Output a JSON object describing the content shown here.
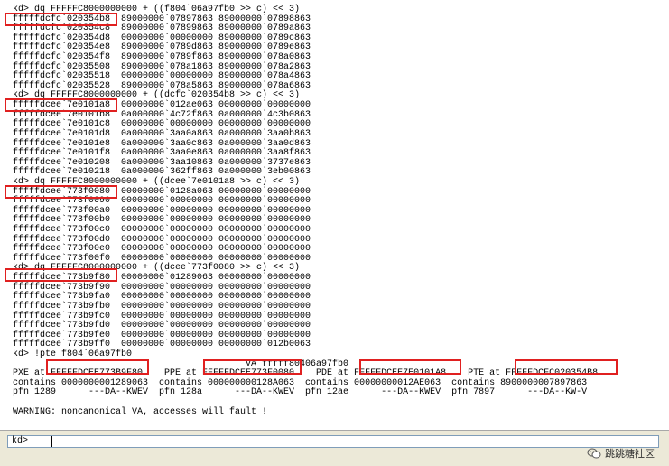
{
  "output_lines": [
    "kd> dq FFFFFC8000000000 + ((f804`06a97fb0 >> c) << 3)",
    "fffffdcfc`020354b8  89000000`07897863 89000000`07898863",
    "fffffdcfc`020354c8  89000000`07899863 89000000`0789a863",
    "fffffdcfc`020354d8  00000000`00000000 89000000`0789c863",
    "fffffdcfc`020354e8  89000000`0789d863 89000000`0789e863",
    "fffffdcfc`020354f8  89000000`0789f863 89000000`078a0863",
    "fffffdcfc`02035508  89000000`078a1863 89000000`078a2863",
    "fffffdcfc`02035518  00000000`00000000 89000000`078a4863",
    "fffffdcfc`02035528  89000000`078a5863 89000000`078a6863",
    "kd> dq FFFFFC8000000000 + ((dcfc`020354b8 >> c) << 3)",
    "fffffdcee`7e0101a8  00000000`012ae063 00000000`00000000",
    "fffffdcee`7e0101b8  0a000000`4c72f863 0a000000`4c3b0863",
    "fffffdcee`7e0101c8  00000000`00000000 00000000`00000000",
    "fffffdcee`7e0101d8  0a000000`3aa0a863 0a000000`3aa0b863",
    "fffffdcee`7e0101e8  0a000000`3aa0c863 0a000000`3aa0d863",
    "fffffdcee`7e0101f8  0a000000`3aa0e863 0a000000`3aa8f863",
    "fffffdcee`7e010208  0a000000`3aa10863 0a000000`3737e863",
    "fffffdcee`7e010218  0a000000`362ff863 0a000000`3eb00863",
    "kd> dq FFFFFC8000000000 + ((dcee`7e0101a8 >> c) << 3)",
    "fffffdcee`773f0080  00000000`0128a063 00000000`00000000",
    "fffffdcee`773f0090  00000000`00000000 00000000`00000000",
    "fffffdcee`773f00a0  00000000`00000000 00000000`00000000",
    "fffffdcee`773f00b0  00000000`00000000 00000000`00000000",
    "fffffdcee`773f00c0  00000000`00000000 00000000`00000000",
    "fffffdcee`773f00d0  00000000`00000000 00000000`00000000",
    "fffffdcee`773f00e0  00000000`00000000 00000000`00000000",
    "fffffdcee`773f00f0  00000000`00000000 00000000`00000000",
    "kd> dq FFFFFC8000000000 + ((dcee`773f0080 >> c) << 3)",
    "fffffdcee`773b9f80  00000000`01289063 00000000`00000000",
    "fffffdcee`773b9f90  00000000`00000000 00000000`00000000",
    "fffffdcee`773b9fa0  00000000`00000000 00000000`00000000",
    "fffffdcee`773b9fb0  00000000`00000000 00000000`00000000",
    "fffffdcee`773b9fc0  00000000`00000000 00000000`00000000",
    "fffffdcee`773b9fd0  00000000`00000000 00000000`00000000",
    "fffffdcee`773b9fe0  00000000`00000000 00000000`00000000",
    "fffffdcee`773b9ff0  00000000`00000000 00000000`012b0063",
    "kd> !pte f804`06a97fb0",
    "                                           VA fffff80406a97fb0",
    "PXE at FFFFFDCEE773B9F80    PPE at FFFFFDCEE773F0080    PDE at FFFFFDCEE7E0101A8    PTE at FFFFFDCFC020354B8",
    "contains 0000000001289063  contains 000000000128A063  contains 00000000012AE063  contains 8900000007897863",
    "pfn 1289      ---DA--KWEV  pfn 128a      ---DA--KWEV  pfn 12ae      ---DA--KWEV  pfn 7897      ---DA--KW-V",
    "",
    "WARNING: noncanonical VA, accesses will fault !"
  ],
  "command": {
    "prompt": "kd>",
    "value": ""
  },
  "watermark": {
    "icon": "wechat-icon",
    "text": "跳跳糖社区"
  },
  "colors": {
    "highlight_box": "#e02020",
    "statusbar": "#ece9d8"
  }
}
